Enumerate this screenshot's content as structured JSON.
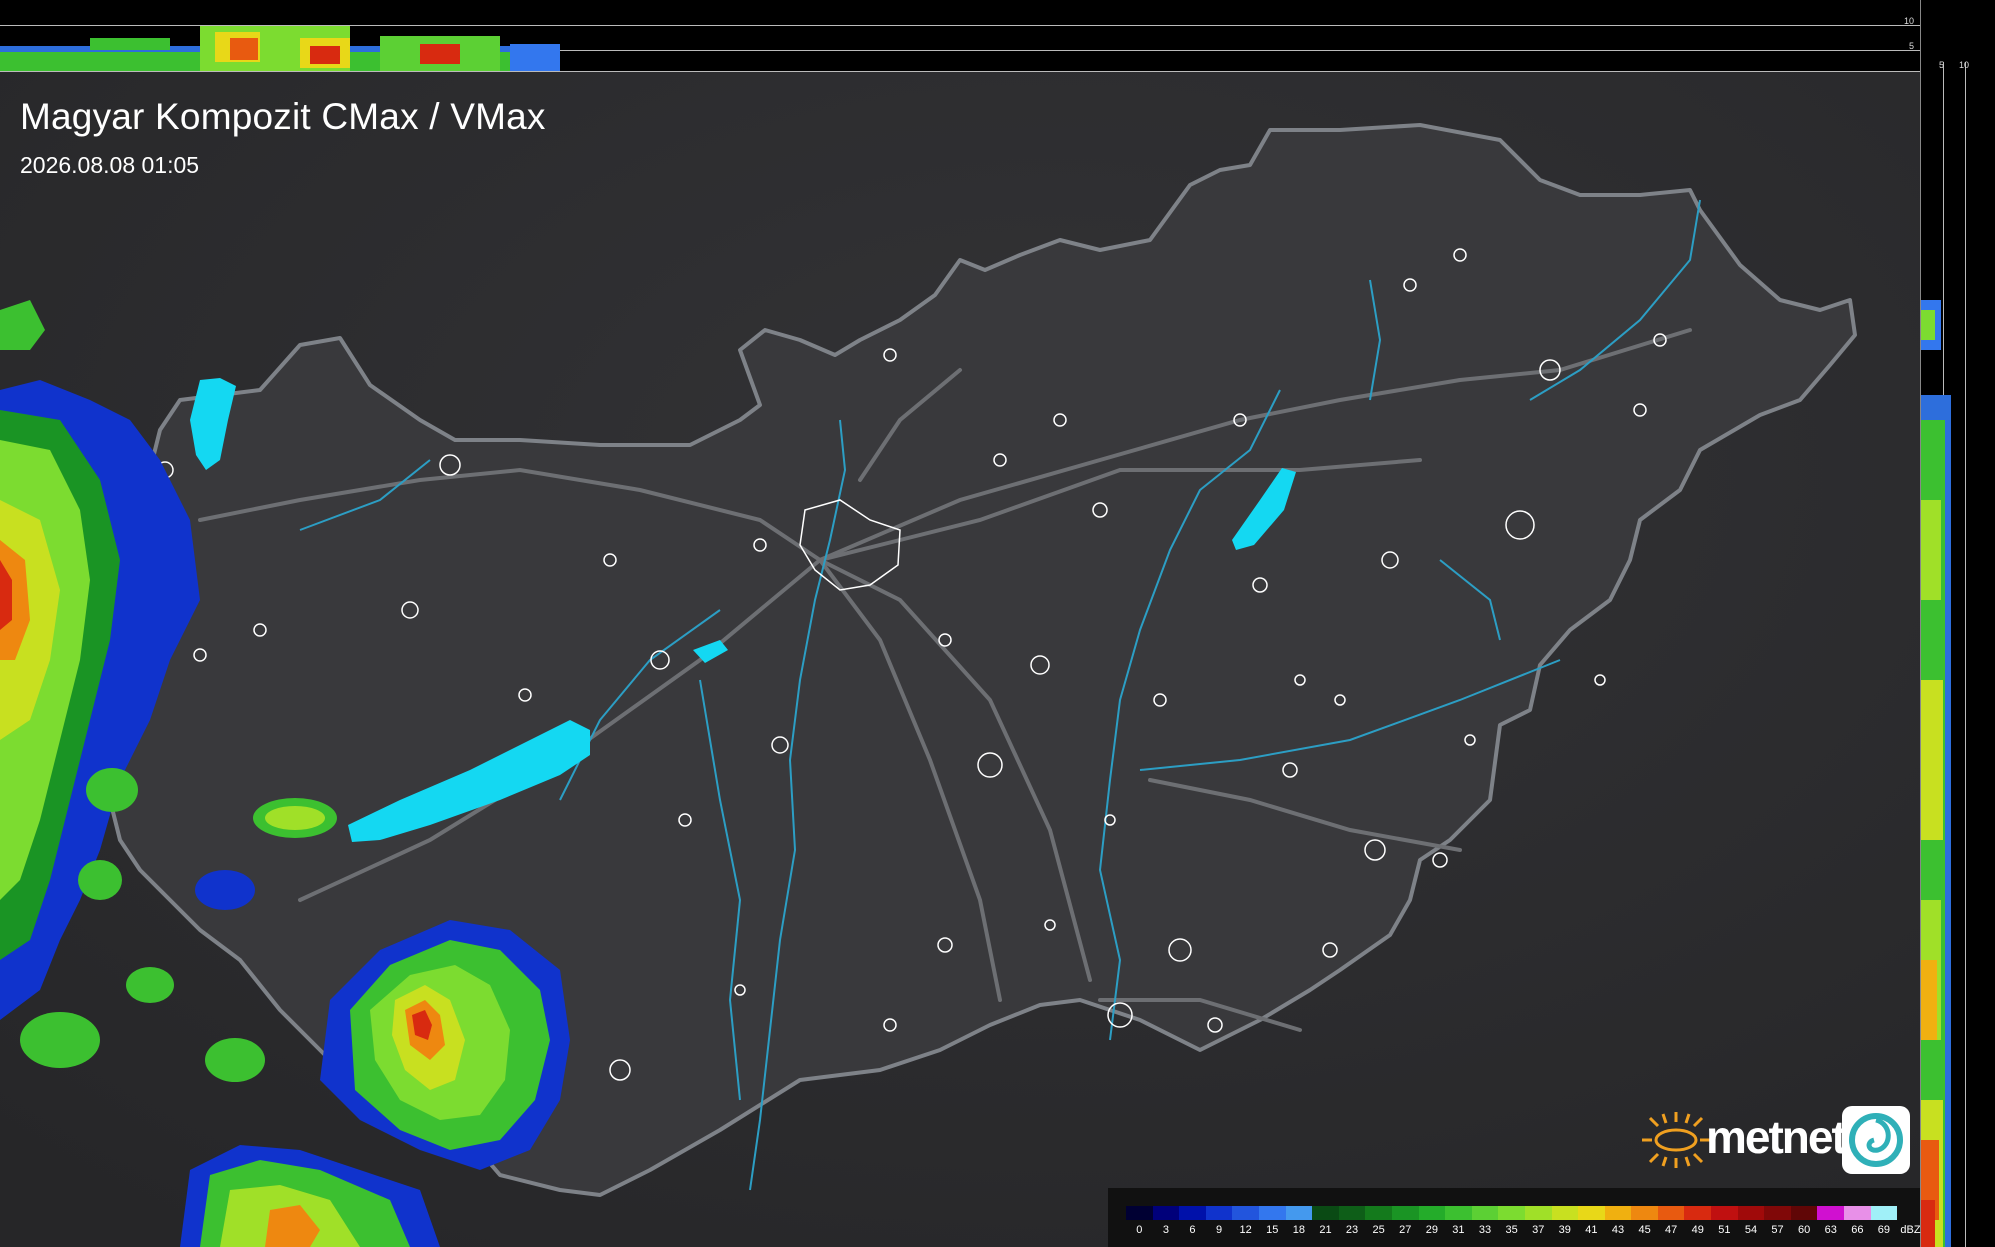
{
  "header": {
    "title": "Magyar Kompozit CMax / VMax",
    "timestamp": "2026.08.08 01:05"
  },
  "cross_sections": {
    "top_ticks": [
      "10",
      "5"
    ],
    "side_ticks": [
      "5",
      "10"
    ]
  },
  "logo": {
    "text": "metnet"
  },
  "legend": {
    "unit": "dBZ",
    "values": [
      "0",
      "3",
      "6",
      "9",
      "12",
      "15",
      "18",
      "21",
      "23",
      "25",
      "27",
      "29",
      "31",
      "33",
      "35",
      "37",
      "39",
      "41",
      "43",
      "45",
      "47",
      "49",
      "51",
      "54",
      "57",
      "60",
      "63",
      "66",
      "69"
    ],
    "colors": [
      "#000033",
      "#00007a",
      "#0011aa",
      "#1033cc",
      "#2255dd",
      "#3377ee",
      "#4499ee",
      "#0a4a14",
      "#0e5e18",
      "#147a1c",
      "#1a9424",
      "#24ac2a",
      "#3cc030",
      "#5cd034",
      "#7cdc30",
      "#a0e028",
      "#c8e020",
      "#e8d818",
      "#f0b010",
      "#ee8810",
      "#e85a10",
      "#d82a10",
      "#c01010",
      "#a00a0a",
      "#800808",
      "#600606",
      "#d010d0",
      "#e890e8",
      "#a0f0f8"
    ]
  },
  "map": {
    "colors": {
      "background": "#2b2b2d",
      "border": "#7e8288",
      "rivers": "#2c9ec4",
      "lakes": "#14d8f2",
      "roads": "#6d6f73",
      "towns": "#ffffff"
    }
  }
}
